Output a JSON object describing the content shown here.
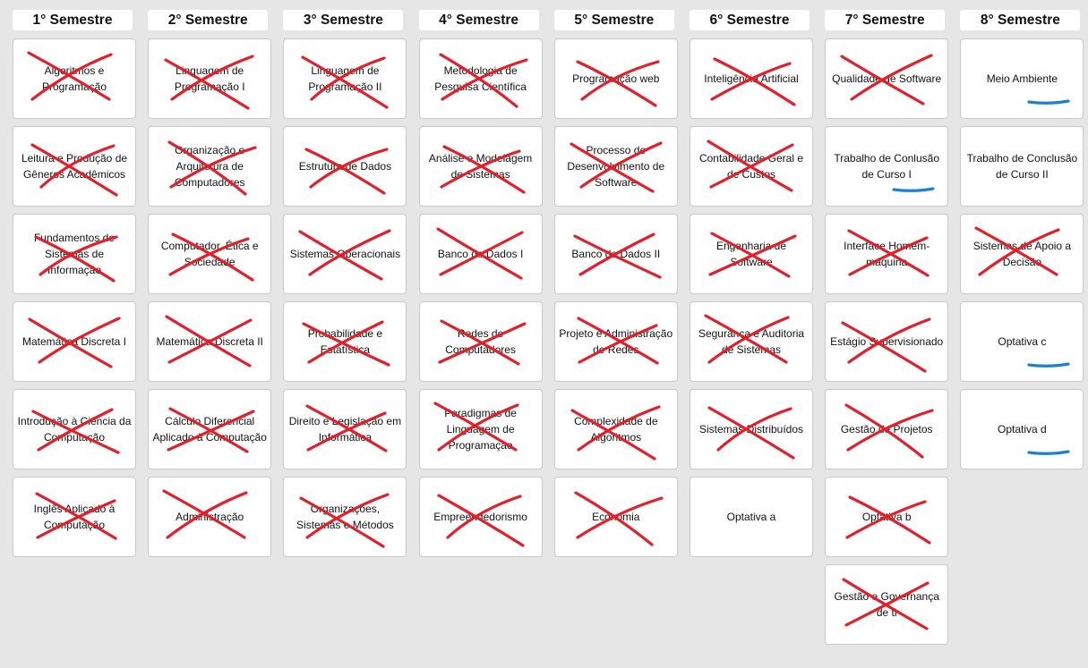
{
  "colors": {
    "background": "#e6e6e6",
    "card": "#ffffff",
    "cross_mark": "#e0202a",
    "underline_mark": "#1a7fd6"
  },
  "semesters": [
    {
      "header": "1° Semestre",
      "courses": [
        {
          "name": "Algoritmos e Programação",
          "mark": "cross"
        },
        {
          "name": "Leitura e Produção de Gêneros Acadêmicos",
          "mark": "cross"
        },
        {
          "name": "Fundamentos de Sistemas de Informação",
          "mark": "cross"
        },
        {
          "name": "Matemática Discreta I",
          "mark": "cross"
        },
        {
          "name": "Introdução à Ciência da Computação",
          "mark": "cross"
        },
        {
          "name": "Inglês Aplicado à Computação",
          "mark": "cross"
        }
      ]
    },
    {
      "header": "2° Semestre",
      "courses": [
        {
          "name": "Linguagem de Programação I",
          "mark": "cross"
        },
        {
          "name": "Organização e Arquitetura de Computadores",
          "mark": "cross"
        },
        {
          "name": "Computador, Ética e Sociedade",
          "mark": "cross"
        },
        {
          "name": "Matemática Discreta II",
          "mark": "cross"
        },
        {
          "name": "Cálculo Diferencial Aplicado à Computação",
          "mark": "cross"
        },
        {
          "name": "Administração",
          "mark": "cross"
        }
      ]
    },
    {
      "header": "3° Semestre",
      "courses": [
        {
          "name": "Linguagem de Programação II",
          "mark": "cross"
        },
        {
          "name": "Estrutura de Dados",
          "mark": "cross"
        },
        {
          "name": "Sistemas Operacionais",
          "mark": "cross"
        },
        {
          "name": "Probabilidade e Estatística",
          "mark": "cross"
        },
        {
          "name": "Direito e Legislação em Informática",
          "mark": "cross"
        },
        {
          "name": "Organizações, Sistemas e Métodos",
          "mark": "cross"
        }
      ]
    },
    {
      "header": "4° Semestre",
      "courses": [
        {
          "name": "Metodologia de Pesquisa Científica",
          "mark": "cross"
        },
        {
          "name": "Análise e Modelagem de Sistemas",
          "mark": "cross"
        },
        {
          "name": "Banco de Dados I",
          "mark": "cross"
        },
        {
          "name": "Redes de Computadores",
          "mark": "cross"
        },
        {
          "name": "Paradigmas de Linguagem de Programação",
          "mark": "cross"
        },
        {
          "name": "Empreendedorismo",
          "mark": "cross"
        }
      ]
    },
    {
      "header": "5° Semestre",
      "courses": [
        {
          "name": "Programação web",
          "mark": "cross"
        },
        {
          "name": "Processo de Desenvolvimento de Software",
          "mark": "cross"
        },
        {
          "name": "Banco de Dados II",
          "mark": "cross"
        },
        {
          "name": "Projeto e Administração de Redes",
          "mark": "cross"
        },
        {
          "name": "Complexidade de Algoritmos",
          "mark": "cross"
        },
        {
          "name": "Economia",
          "mark": "cross"
        }
      ]
    },
    {
      "header": "6° Semestre",
      "courses": [
        {
          "name": "Inteligência Artificial",
          "mark": "cross"
        },
        {
          "name": "Contabilidade Geral e de Custos",
          "mark": "cross"
        },
        {
          "name": "Engenharia de Software",
          "mark": "cross"
        },
        {
          "name": "Segurança e Auditoria de Sistemas",
          "mark": "cross"
        },
        {
          "name": "Sistemas Distribuídos",
          "mark": "cross"
        },
        {
          "name": "Optativa a",
          "mark": "none"
        }
      ]
    },
    {
      "header": "7° Semestre",
      "courses": [
        {
          "name": "Qualidade de Software",
          "mark": "cross"
        },
        {
          "name": "Trabalho de Conlusão de Curso I",
          "mark": "underline"
        },
        {
          "name": "Interface Homem-maquina",
          "mark": "cross"
        },
        {
          "name": "Estágio Supervisionado",
          "mark": "cross"
        },
        {
          "name": "Gestão de Projetos",
          "mark": "cross"
        },
        {
          "name": "Optativa b",
          "mark": "cross"
        },
        {
          "name": "Gestão e Governança de ti",
          "mark": "cross"
        }
      ]
    },
    {
      "header": "8° Semestre",
      "courses": [
        {
          "name": "Meio Ambiente",
          "mark": "underline"
        },
        {
          "name": "Trabalho de Conclusão de Curso II",
          "mark": "none"
        },
        {
          "name": "Sistemas de Apoio a Decisão",
          "mark": "cross"
        },
        {
          "name": "Optativa c",
          "mark": "underline"
        },
        {
          "name": "Optativa d",
          "mark": "underline"
        }
      ]
    }
  ]
}
